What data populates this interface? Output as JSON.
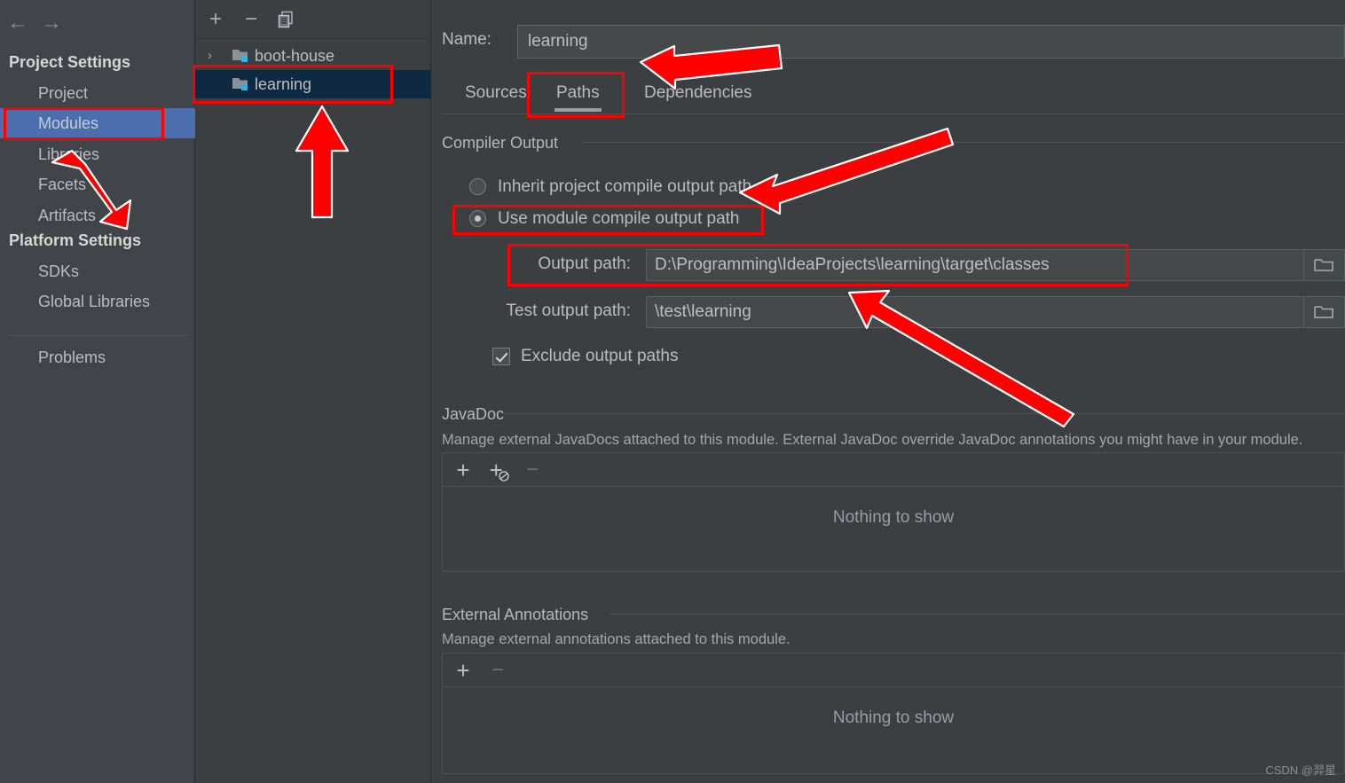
{
  "sidebar": {
    "nav": {
      "back_icon": "arrow-left-icon",
      "forward_icon": "arrow-right-icon"
    },
    "groups": [
      {
        "title": "Project Settings",
        "items": [
          {
            "label": "Project",
            "selected": false
          },
          {
            "label": "Modules",
            "selected": true
          },
          {
            "label": "Libraries",
            "selected": false
          },
          {
            "label": "Facets",
            "selected": false
          },
          {
            "label": "Artifacts",
            "selected": false
          }
        ]
      },
      {
        "title": "Platform Settings",
        "items": [
          {
            "label": "SDKs",
            "selected": false
          },
          {
            "label": "Global Libraries",
            "selected": false
          }
        ]
      }
    ],
    "problems_label": "Problems",
    "selection_color": "#4b6eaf"
  },
  "tree": {
    "toolbar": [
      {
        "name": "add-module-button",
        "icon": "plus-icon",
        "label": "+"
      },
      {
        "name": "remove-module-button",
        "icon": "minus-icon",
        "label": "−"
      },
      {
        "name": "copy-module-button",
        "icon": "copy-icon",
        "label": ""
      }
    ],
    "rows": [
      {
        "label": "boot-house",
        "expandable": true,
        "arrow": "›",
        "selected": false,
        "icon": "module-folder-icon"
      },
      {
        "label": "learning",
        "expandable": false,
        "arrow": "",
        "selected": true,
        "icon": "module-folder-icon"
      }
    ],
    "selection_color": "#0d2a42"
  },
  "detail": {
    "name_label": "Name:",
    "name_value": "learning",
    "tabs": [
      {
        "label": "Sources",
        "active": false
      },
      {
        "label": "Paths",
        "active": true
      },
      {
        "label": "Dependencies",
        "active": false
      }
    ],
    "compiler_output": {
      "group_title": "Compiler Output",
      "radio_inherit": "Inherit project compile output path",
      "radio_module": "Use module compile output path",
      "selected_radio": "module",
      "output_path_label": "Output path:",
      "output_path_value": "D:\\Programming\\IdeaProjects\\learning\\target\\classes",
      "test_output_path_label": "Test output path:",
      "test_output_path_value": "\\test\\learning",
      "exclude_label": "Exclude output paths",
      "exclude_checked": true,
      "browse_icon": "folder-icon"
    },
    "javadoc": {
      "group_title": "JavaDoc",
      "description": "Manage external JavaDocs attached to this module. External JavaDoc override JavaDoc annotations you might have in your module.",
      "toolbar": [
        {
          "name": "add-javadoc-button",
          "icon": "plus-icon",
          "label": "+",
          "disabled": false
        },
        {
          "name": "add-javadoc-url-button",
          "icon": "plus-globe-icon",
          "label": "+",
          "disabled": false
        },
        {
          "name": "remove-javadoc-button",
          "icon": "minus-icon",
          "label": "−",
          "disabled": true
        }
      ],
      "empty_text": "Nothing to show"
    },
    "external_annotations": {
      "group_title": "External Annotations",
      "description": "Manage external annotations attached to this module.",
      "toolbar": [
        {
          "name": "add-annotation-button",
          "icon": "plus-icon",
          "label": "+",
          "disabled": false
        },
        {
          "name": "remove-annotation-button",
          "icon": "minus-icon",
          "label": "−",
          "disabled": true
        }
      ],
      "empty_text": "Nothing to show"
    }
  },
  "annotations": {
    "highlight_color": "#fe0000",
    "boxes": [
      "modules-sidebar-item",
      "learning-tree-row",
      "paths-tab",
      "use-module-output-radio",
      "output-path-field"
    ],
    "arrows": [
      "arrow-to-modules",
      "arrow-to-learning-row",
      "arrow-to-paths-tab",
      "arrow-to-inherit-radio",
      "arrow-to-output-path"
    ]
  },
  "watermark": "CSDN @羿星"
}
